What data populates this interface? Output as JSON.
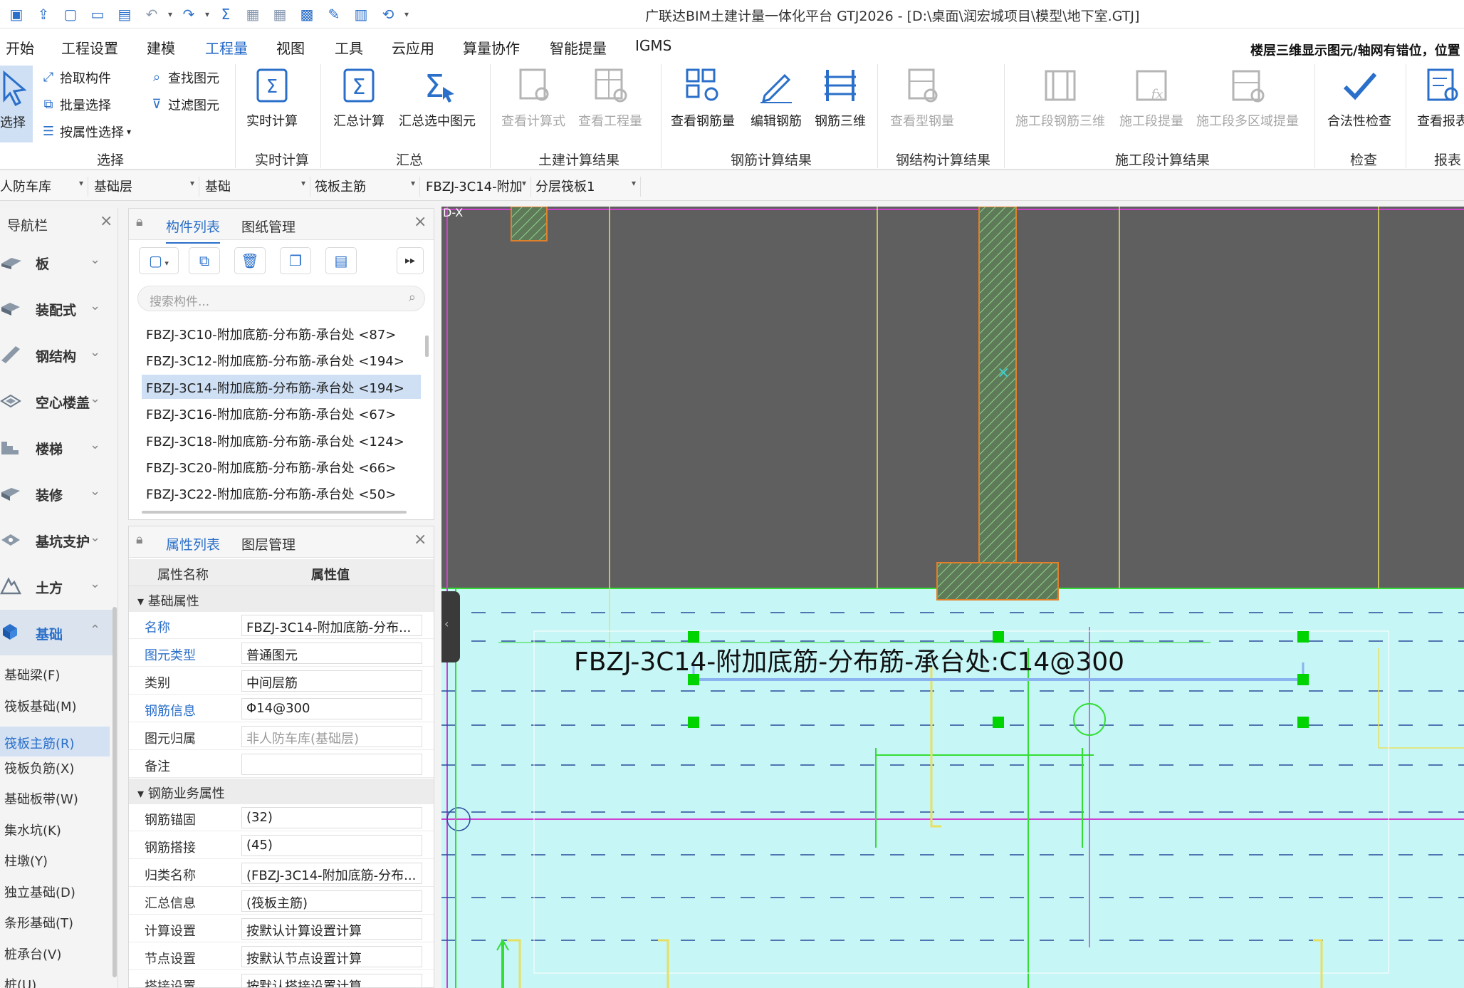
{
  "app": {
    "title": "广联达BIM土建计量一体化平台 GTJ2026 - [D:\\桌面\\润宏城项目\\模型\\地下室.GTJ]"
  },
  "menu": {
    "items": [
      "开始",
      "工程设置",
      "建模",
      "工程量",
      "视图",
      "工具",
      "云应用",
      "算量协作",
      "智能提量",
      "IGMS"
    ],
    "active_index": 3,
    "hint": "楼层三维显示图元/轴网有错位，位置"
  },
  "ribbon": {
    "select": {
      "select_label": "选择",
      "pick": "拾取构件",
      "batch": "批量选择",
      "by_attr": "按属性选择",
      "find": "查找图元",
      "filter": "过滤图元",
      "group": "选择"
    },
    "realtime": {
      "calc": "实时计算",
      "group": "实时计算"
    },
    "summary": {
      "calc": "汇总计算",
      "calc_selected": "汇总选中图元",
      "group": "汇总"
    },
    "civil": {
      "view_formula": "查看计算式",
      "view_quantity": "查看工程量",
      "group": "土建计算结果"
    },
    "rebar": {
      "view_amount": "查看钢筋量",
      "edit": "编辑钢筋",
      "three_d": "钢筋三维",
      "group": "钢筋计算结果"
    },
    "steel": {
      "view": "查看型钢量",
      "group": "钢结构计算结果"
    },
    "stage": {
      "rebar3d": "施工段钢筋三维",
      "quantity": "施工段提量",
      "multi": "施工段多区域提量",
      "group": "施工段计算结果"
    },
    "check": {
      "legality": "合法性检查",
      "group": "检查"
    },
    "report": {
      "view": "查看报表",
      "group": "报表"
    }
  },
  "filterbar": {
    "dropdowns": [
      "人防车库",
      "基础层",
      "基础",
      "筏板主筋",
      "FBZJ-3C14-附加",
      "分层筏板1"
    ]
  },
  "nav": {
    "title": "导航栏",
    "categories": [
      "板",
      "装配式",
      "钢结构",
      "空心楼盖",
      "楼梯",
      "装修",
      "基坑支护",
      "土方",
      "基础"
    ],
    "active_category": "基础",
    "sub_items": [
      "基础梁(F)",
      "筏板基础(M)",
      "筏板主筋(R)",
      "筏板负筋(X)",
      "基础板带(W)",
      "集水坑(K)",
      "柱墩(Y)",
      "独立基础(D)",
      "条形基础(T)",
      "桩承台(V)",
      "桩(U)"
    ],
    "active_sub": "筏板主筋(R)"
  },
  "component_panel": {
    "tabs": [
      "构件列表",
      "图纸管理"
    ],
    "search_placeholder": "搜索构件...",
    "items": [
      "FBZJ-3C10-附加底筋-分布筋-承台处 <87>",
      "FBZJ-3C12-附加底筋-分布筋-承台处 <194>",
      "FBZJ-3C14-附加底筋-分布筋-承台处 <194>",
      "FBZJ-3C16-附加底筋-分布筋-承台处 <67>",
      "FBZJ-3C18-附加底筋-分布筋-承台处 <124>",
      "FBZJ-3C20-附加底筋-分布筋-承台处 <66>",
      "FBZJ-3C22-附加底筋-分布筋-承台处 <50>"
    ],
    "active_index": 2
  },
  "property_panel": {
    "tabs": [
      "属性列表",
      "图层管理"
    ],
    "col_name": "属性名称",
    "col_value": "属性值",
    "groups": {
      "basic": "基础属性",
      "rebar_business": "钢筋业务属性"
    },
    "basic_rows": [
      {
        "name": "名称",
        "value": "FBZJ-3C14-附加底筋-分布...",
        "blue": true,
        "grey": false
      },
      {
        "name": "图元类型",
        "value": "普通图元",
        "blue": true,
        "grey": false
      },
      {
        "name": "类别",
        "value": "中间层筋",
        "blue": false,
        "grey": false
      },
      {
        "name": "钢筋信息",
        "value": "Φ14@300",
        "blue": true,
        "grey": false
      },
      {
        "name": "图元归属",
        "value": "非人防车库(基础层)",
        "blue": false,
        "grey": true
      },
      {
        "name": "备注",
        "value": "",
        "blue": false,
        "grey": false
      }
    ],
    "rebar_rows": [
      {
        "name": "钢筋锚固",
        "value": "(32)"
      },
      {
        "name": "钢筋搭接",
        "value": "(45)"
      },
      {
        "name": "归类名称",
        "value": "(FBZJ-3C14-附加底筋-分布..."
      },
      {
        "name": "汇总信息",
        "value": "(筏板主筋)"
      },
      {
        "name": "计算设置",
        "value": "按默认计算设置计算"
      },
      {
        "name": "节点设置",
        "value": "按默认节点设置计算"
      },
      {
        "name": "搭接设置",
        "value": "按默认搭接设置计算"
      }
    ]
  },
  "canvas": {
    "rebar_label": "FBZJ-3C14-附加底筋-分布筋-承台处:C14@300",
    "corner_tag": "D-X",
    "colors": {
      "wall_bg": "#5f5f5f",
      "slab_bg": "#c6f6f6",
      "hatch": "#7cc47a",
      "hatch_edge": "#e0802a",
      "grip": "#00d400",
      "selected_line": "#8ab4f0",
      "axis_magenta": "#d040d0",
      "yellow": "#e8e060"
    }
  }
}
